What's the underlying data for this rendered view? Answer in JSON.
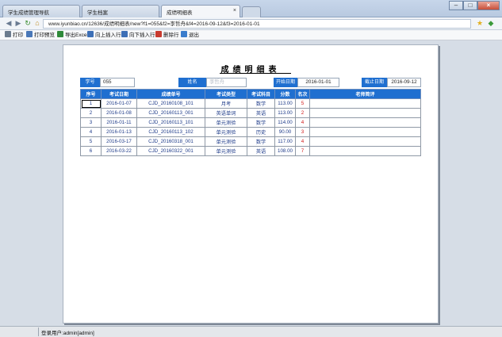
{
  "browser": {
    "tabs": [
      {
        "label": "学生成绩管理导航",
        "active": false
      },
      {
        "label": "学生档案",
        "active": false
      },
      {
        "label": "成绩明细表",
        "active": true
      }
    ],
    "url": "www.iyunbiao.cn/12636/成绩明细表/new?f1=055&f2=李哲舟&f4=2016-09-12&f3=2016-01-01"
  },
  "toolbar": {
    "print": "打印",
    "print_preview": "打印预览",
    "export_excel": "导出Excel",
    "insert_above": "向上插入行",
    "insert_below": "向下插入行",
    "delete_row": "删除行",
    "exit": "退出"
  },
  "report": {
    "title": "成绩明细表",
    "student_id_label": "学号",
    "student_id": "055",
    "name_label": "姓名",
    "name": "李哲舟",
    "start_date_label": "开始日期",
    "start_date": "2016-01-01",
    "end_date_label": "截止日期",
    "end_date": "2016-09-12",
    "columns": [
      "序号",
      "考试日期",
      "成绩单号",
      "考试类型",
      "考试科目",
      "分数",
      "名次",
      "老师简评"
    ],
    "rows": [
      {
        "seq": "1",
        "date": "2016-01-07",
        "no": "CJD_20160108_101",
        "type": "月考",
        "subject": "数学",
        "score": "113.00",
        "rank": "5",
        "comment": ""
      },
      {
        "seq": "2",
        "date": "2016-01-08",
        "no": "CJD_20160113_001",
        "type": "英语单词",
        "subject": "英语",
        "score": "113.00",
        "rank": "2",
        "comment": ""
      },
      {
        "seq": "3",
        "date": "2016-01-11",
        "no": "CJD_20160113_101",
        "type": "单元测验",
        "subject": "数学",
        "score": "114.00",
        "rank": "4",
        "comment": ""
      },
      {
        "seq": "4",
        "date": "2016-01-13",
        "no": "CJD_20160113_102",
        "type": "单元测验",
        "subject": "历史",
        "score": "90.00",
        "rank": "3",
        "comment": ""
      },
      {
        "seq": "5",
        "date": "2016-03-17",
        "no": "CJD_20160318_001",
        "type": "单元测验",
        "subject": "数学",
        "score": "117.00",
        "rank": "4",
        "comment": ""
      },
      {
        "seq": "6",
        "date": "2016-03-22",
        "no": "CJD_20160322_001",
        "type": "单元测验",
        "subject": "英语",
        "score": "108.00",
        "rank": "7",
        "comment": ""
      }
    ]
  },
  "status": {
    "login_user": "登录用户:admin[admin]"
  }
}
